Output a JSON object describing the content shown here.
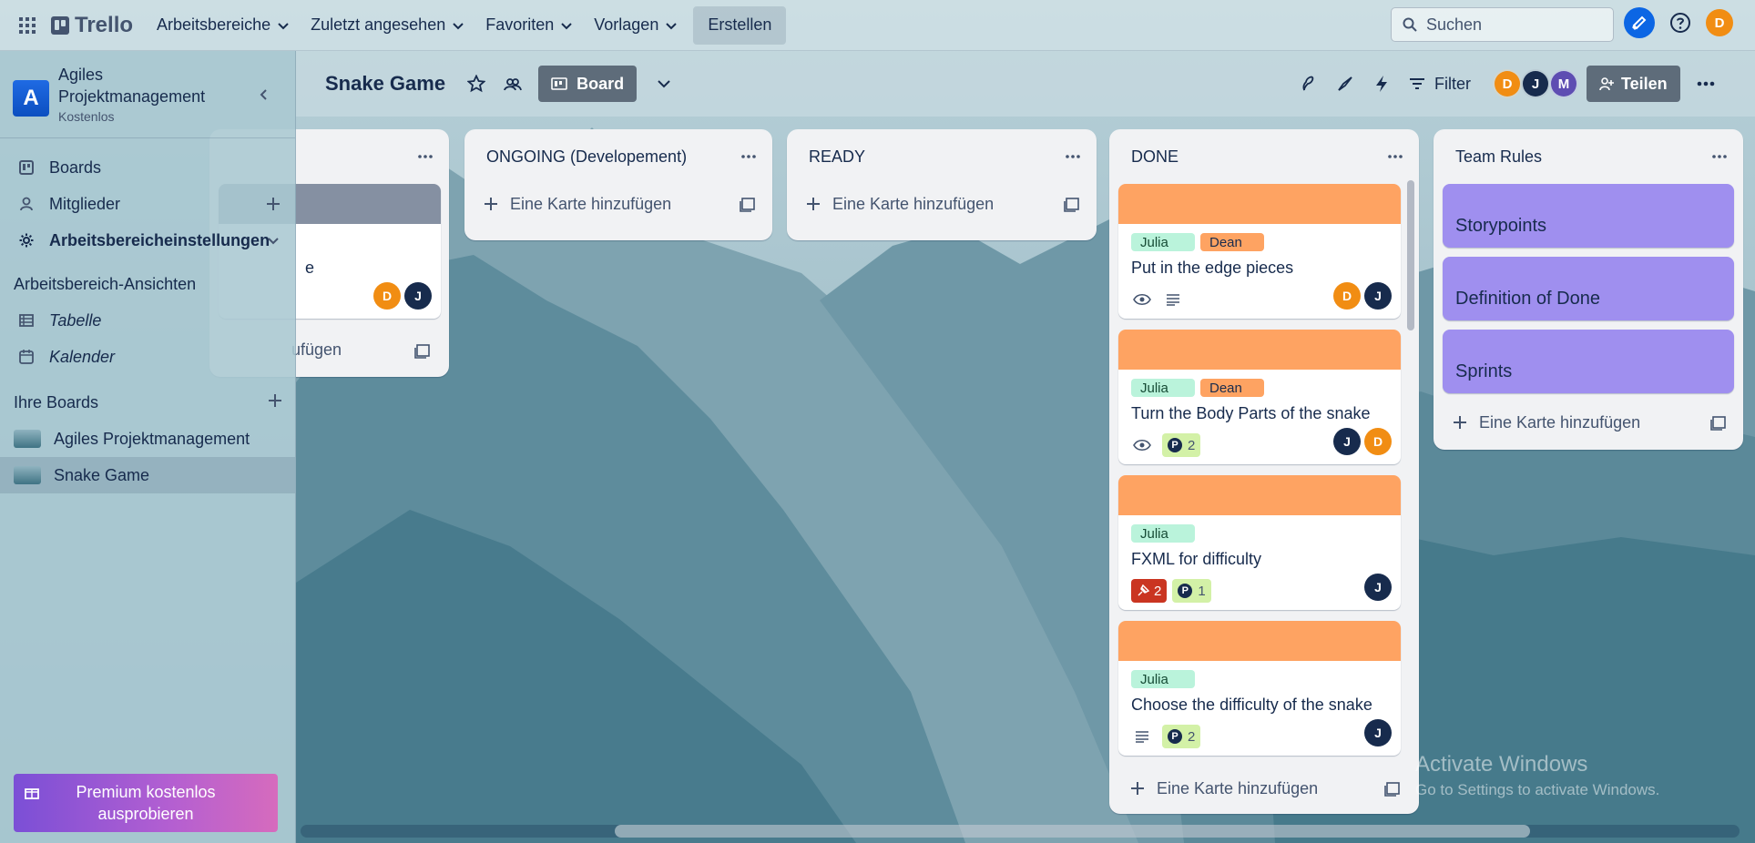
{
  "topbar": {
    "logo": "Trello",
    "nav": [
      "Arbeitsbereiche",
      "Zuletzt angesehen",
      "Favoriten",
      "Vorlagen"
    ],
    "create": "Erstellen",
    "search_placeholder": "Suchen",
    "user_initial": "D"
  },
  "sidebar": {
    "workspace_initial": "A",
    "workspace_name": "Agiles Projektmanagement",
    "workspace_plan": "Kostenlos",
    "items": {
      "boards": "Boards",
      "members": "Mitglieder",
      "settings": "Arbeitsbereicheinstellungen"
    },
    "views_title": "Arbeitsbereich-Ansichten",
    "views": [
      "Tabelle",
      "Kalender"
    ],
    "boards_title": "Ihre Boards",
    "boards": [
      "Agiles Projektmanagement",
      "Snake Game"
    ],
    "premium": "Premium kostenlos ausprobieren"
  },
  "board": {
    "title": "Snake Game",
    "view": "Board",
    "filter": "Filter",
    "members": [
      {
        "initial": "D",
        "color": "#f18d13"
      },
      {
        "initial": "J",
        "color": "#172b4d"
      },
      {
        "initial": "M",
        "color": "#5e4db2"
      }
    ],
    "share": "Teilen"
  },
  "lists": {
    "partial": {
      "add": "ufügen",
      "card_fragment": "e",
      "avatars": [
        "D",
        "J"
      ]
    },
    "ongoing": {
      "title": "ONGOING (Developement)",
      "add": "Eine Karte hinzufügen"
    },
    "ready": {
      "title": "READY",
      "add": "Eine Karte hinzufügen"
    },
    "done": {
      "title": "DONE",
      "add": "Eine Karte hinzufügen",
      "cards": [
        {
          "labels": [
            "Julia",
            "Dean"
          ],
          "title": "Put in the edge pieces",
          "badges": {
            "watch": true,
            "desc": true
          },
          "avatars": [
            "D",
            "J"
          ]
        },
        {
          "labels": [
            "Julia",
            "Dean"
          ],
          "title": "Turn the Body Parts of the snake",
          "badges": {
            "watch": true,
            "points": "2"
          },
          "avatars": [
            "J",
            "D"
          ]
        },
        {
          "labels": [
            "Julia"
          ],
          "title": "FXML for difficulty",
          "badges": {
            "pins": "2",
            "points": "1"
          },
          "avatars": [
            "J"
          ]
        },
        {
          "labels": [
            "Julia"
          ],
          "title": "Choose the difficulty of the snake",
          "badges": {
            "desc": true,
            "points": "2"
          },
          "avatars": [
            "J"
          ]
        }
      ]
    },
    "team_rules": {
      "title": "Team Rules",
      "cards": [
        "Storypoints",
        "Definition of Done",
        "Sprints"
      ],
      "add": "Eine Karte hinzufügen"
    }
  },
  "watermark": {
    "line1": "Activate Windows",
    "line2": "Go to Settings to activate Windows."
  },
  "colors": {
    "accent": "#0c66e4",
    "cover": "#fea362",
    "label_julia": "#baf3db",
    "label_dean": "#fea362",
    "purple_card": "#9f8fef"
  }
}
